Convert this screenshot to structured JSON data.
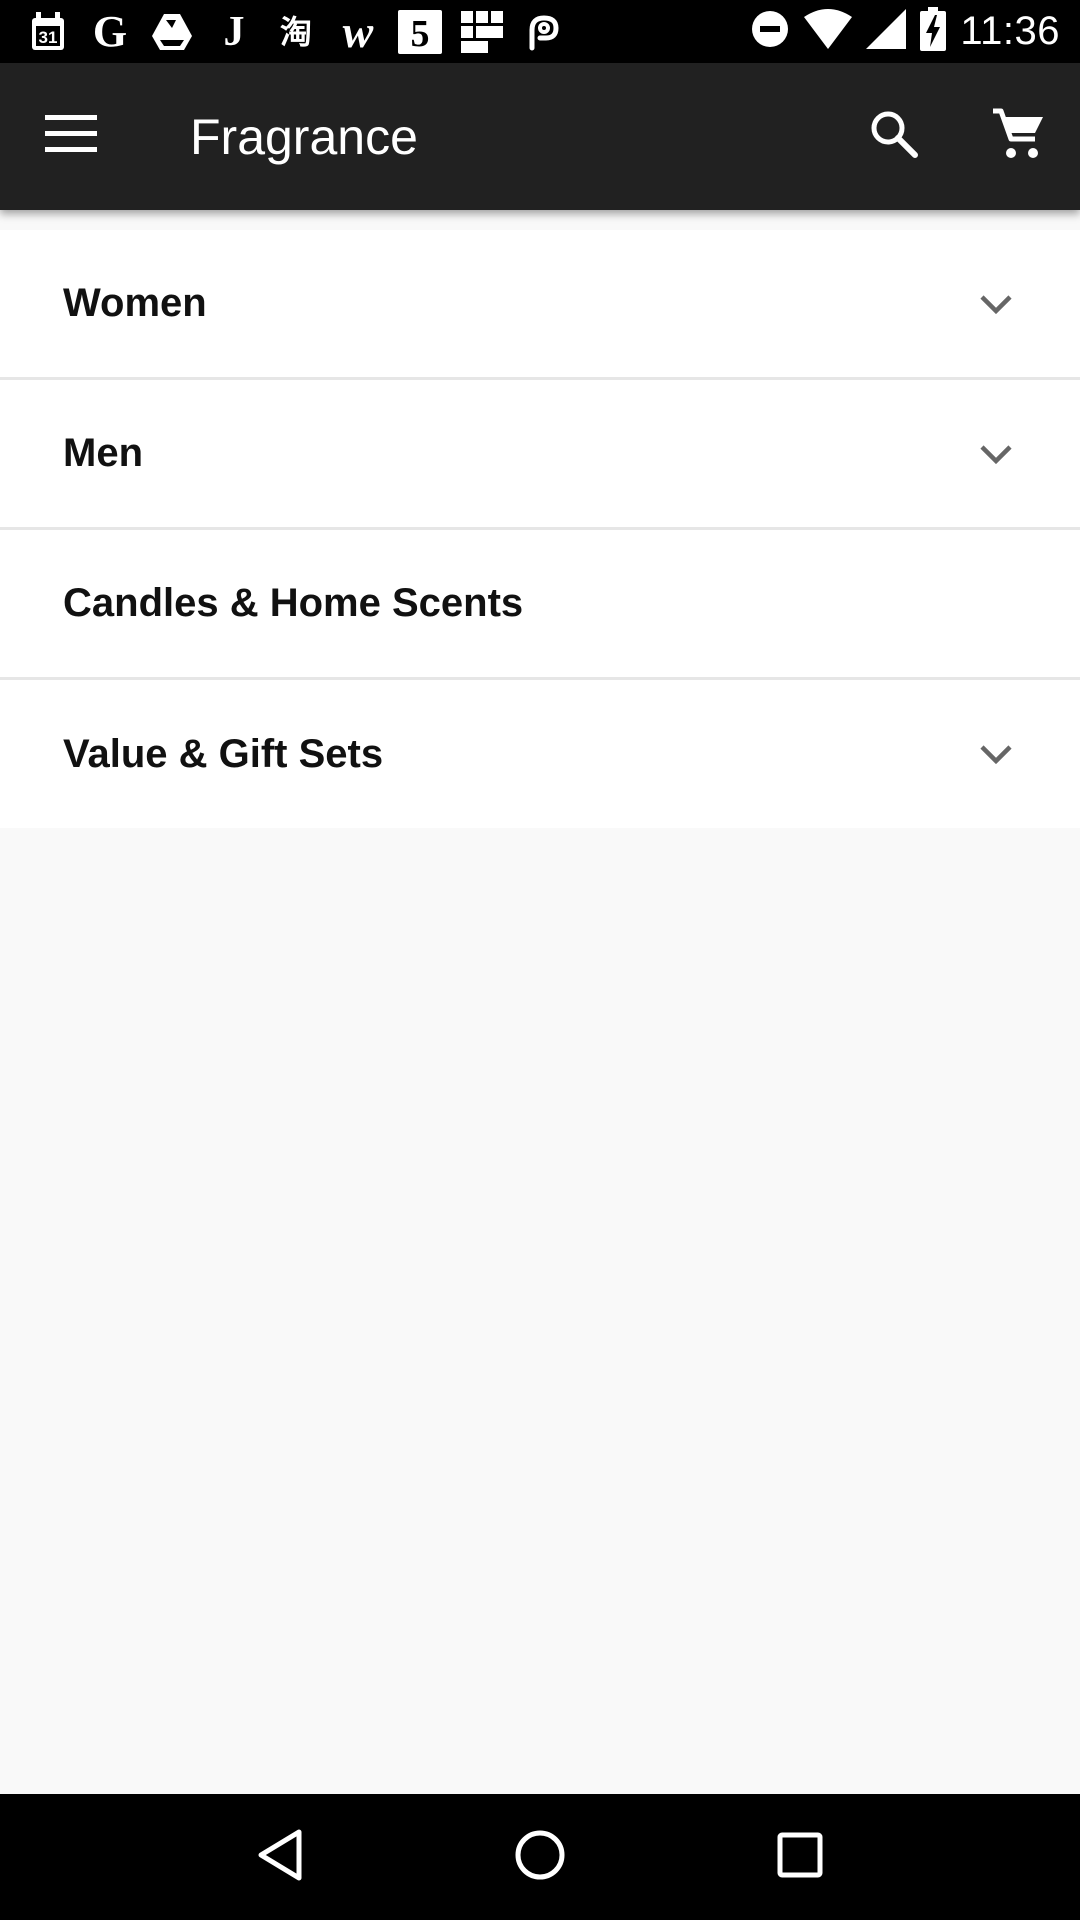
{
  "status_bar": {
    "time": "11:36",
    "notification_icons": [
      {
        "name": "calendar-icon"
      },
      {
        "name": "google-icon",
        "glyph": "G"
      },
      {
        "name": "drive-icon"
      },
      {
        "name": "j-app-icon",
        "glyph": "J"
      },
      {
        "name": "taobao-icon",
        "glyph": "淘"
      },
      {
        "name": "wish-icon",
        "glyph": "w"
      },
      {
        "name": "five-app-icon",
        "glyph": "5"
      },
      {
        "name": "grid-app-icon"
      },
      {
        "name": "link-app-icon"
      }
    ],
    "system_icons": [
      "do-not-disturb-icon",
      "wifi-icon",
      "cell-signal-icon",
      "battery-charging-icon"
    ]
  },
  "app_bar": {
    "title": "Fragrance",
    "menu_icon": "hamburger-menu-icon",
    "search_icon": "search-icon",
    "cart_icon": "shopping-cart-icon",
    "background": "#212121"
  },
  "categories": [
    {
      "label": "Women",
      "expandable": true
    },
    {
      "label": "Men",
      "expandable": true
    },
    {
      "label": "Candles & Home Scents",
      "expandable": false
    },
    {
      "label": "Value & Gift Sets",
      "expandable": true
    }
  ],
  "nav_bar": {
    "buttons": [
      "back-icon",
      "home-icon",
      "recents-icon"
    ]
  }
}
